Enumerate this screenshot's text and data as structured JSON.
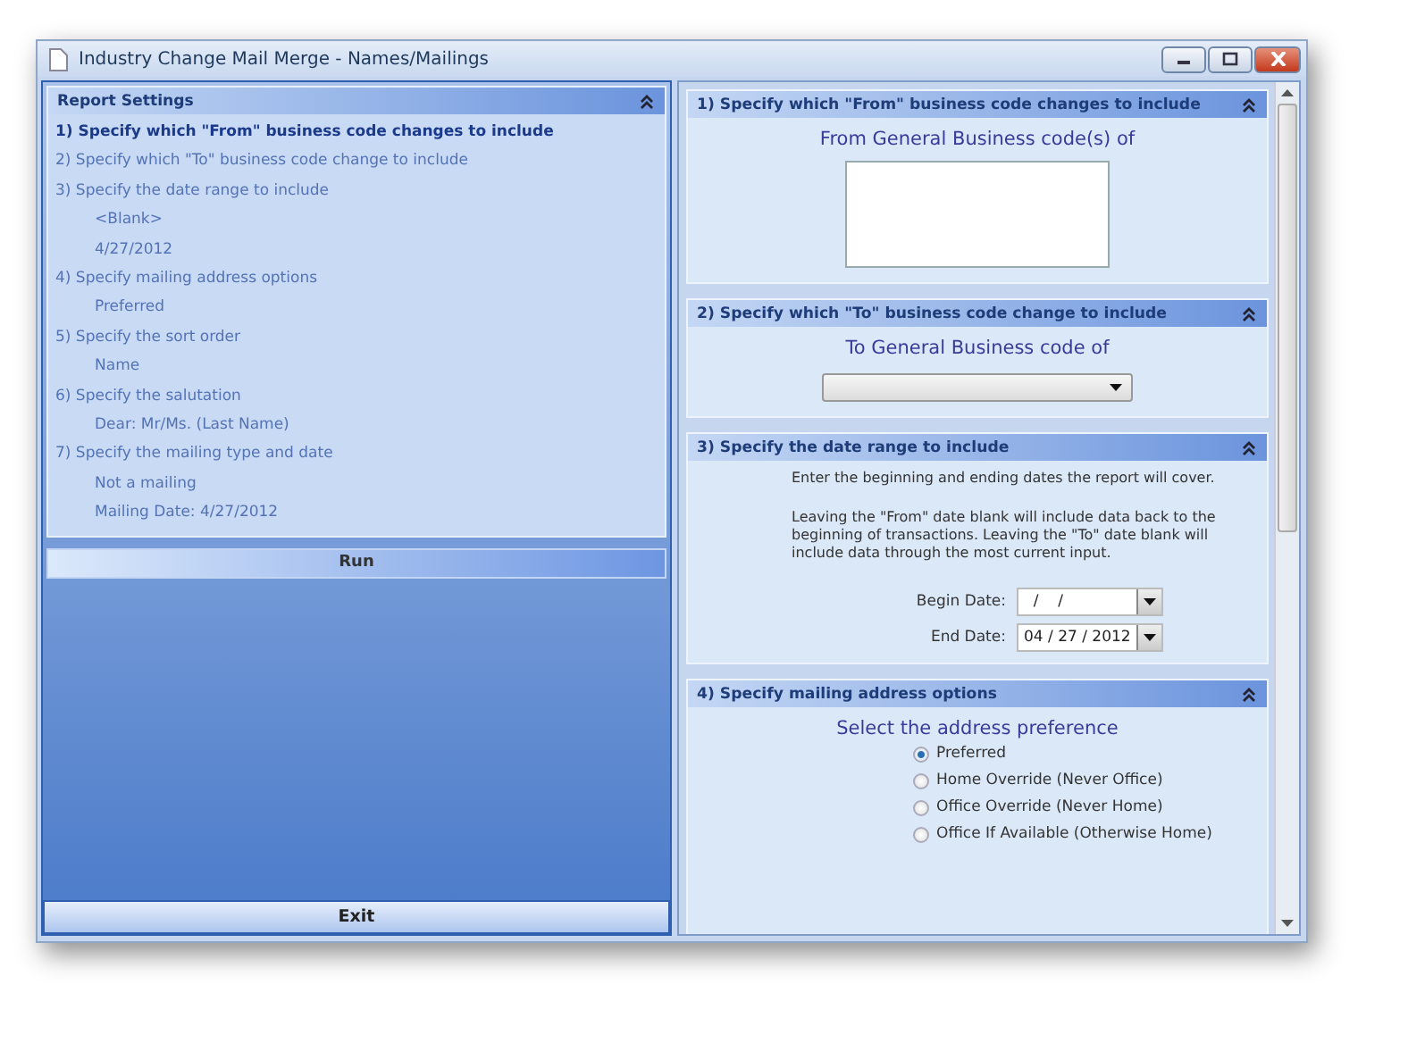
{
  "window": {
    "title": "Industry Change Mail Merge - Names/Mailings"
  },
  "summary": {
    "title": "Report Settings",
    "items": [
      {
        "kind": "step",
        "text": "1)  Specify which \"From\" business code changes to include",
        "selected": true
      },
      {
        "kind": "step",
        "text": "2)  Specify which \"To\" business code change to include",
        "selected": false
      },
      {
        "kind": "step",
        "text": "3)  Specify the date range to include",
        "selected": false
      },
      {
        "kind": "value",
        "text": "<Blank>",
        "selected": false
      },
      {
        "kind": "value",
        "text": "4/27/2012",
        "selected": false
      },
      {
        "kind": "step",
        "text": "4)  Specify mailing address options",
        "selected": false
      },
      {
        "kind": "value",
        "text": "Preferred",
        "selected": false
      },
      {
        "kind": "step",
        "text": "5)  Specify the sort order",
        "selected": false
      },
      {
        "kind": "value",
        "text": "Name",
        "selected": false
      },
      {
        "kind": "step",
        "text": "6)  Specify the salutation",
        "selected": false
      },
      {
        "kind": "value",
        "text": "Dear:  Mr/Ms. (Last Name)",
        "selected": false
      },
      {
        "kind": "step",
        "text": "7)  Specify the mailing type and date",
        "selected": false
      },
      {
        "kind": "value",
        "text": "Not a mailing",
        "selected": false
      },
      {
        "kind": "value",
        "text": "Mailing Date:  4/27/2012",
        "selected": false
      }
    ]
  },
  "run_button": "Run",
  "exit_button": "Exit",
  "sections": [
    {
      "kind": "list_box",
      "title": "1)  Specify which \"From\" business code changes to include",
      "label": "From General Business code(s) of"
    },
    {
      "kind": "dropdown",
      "title": "2)  Specify which \"To\" business code change to include",
      "label": "To General Business code of"
    },
    {
      "kind": "dates",
      "title": "3)  Specify the date range to include",
      "notes": [
        "Enter the beginning and ending dates the report will cover.",
        "Leaving the \"From\" date blank will include data back to the beginning of transactions.  Leaving the \"To\" date blank will include data through the most current input."
      ],
      "fields": [
        {
          "label": "Begin Date:",
          "value": "  /    /"
        },
        {
          "label": "End Date:",
          "value": "04 / 27 / 2012"
        }
      ]
    },
    {
      "kind": "radios",
      "title": "4)  Specify mailing address options",
      "label": "Select the address preference",
      "options": [
        {
          "label": "Preferred",
          "selected": true
        },
        {
          "label": "Home Override (Never Office)",
          "selected": false
        },
        {
          "label": "Office Override (Never Home)",
          "selected": false
        },
        {
          "label": "Office If Available (Otherwise Home)",
          "selected": false
        }
      ]
    }
  ]
}
